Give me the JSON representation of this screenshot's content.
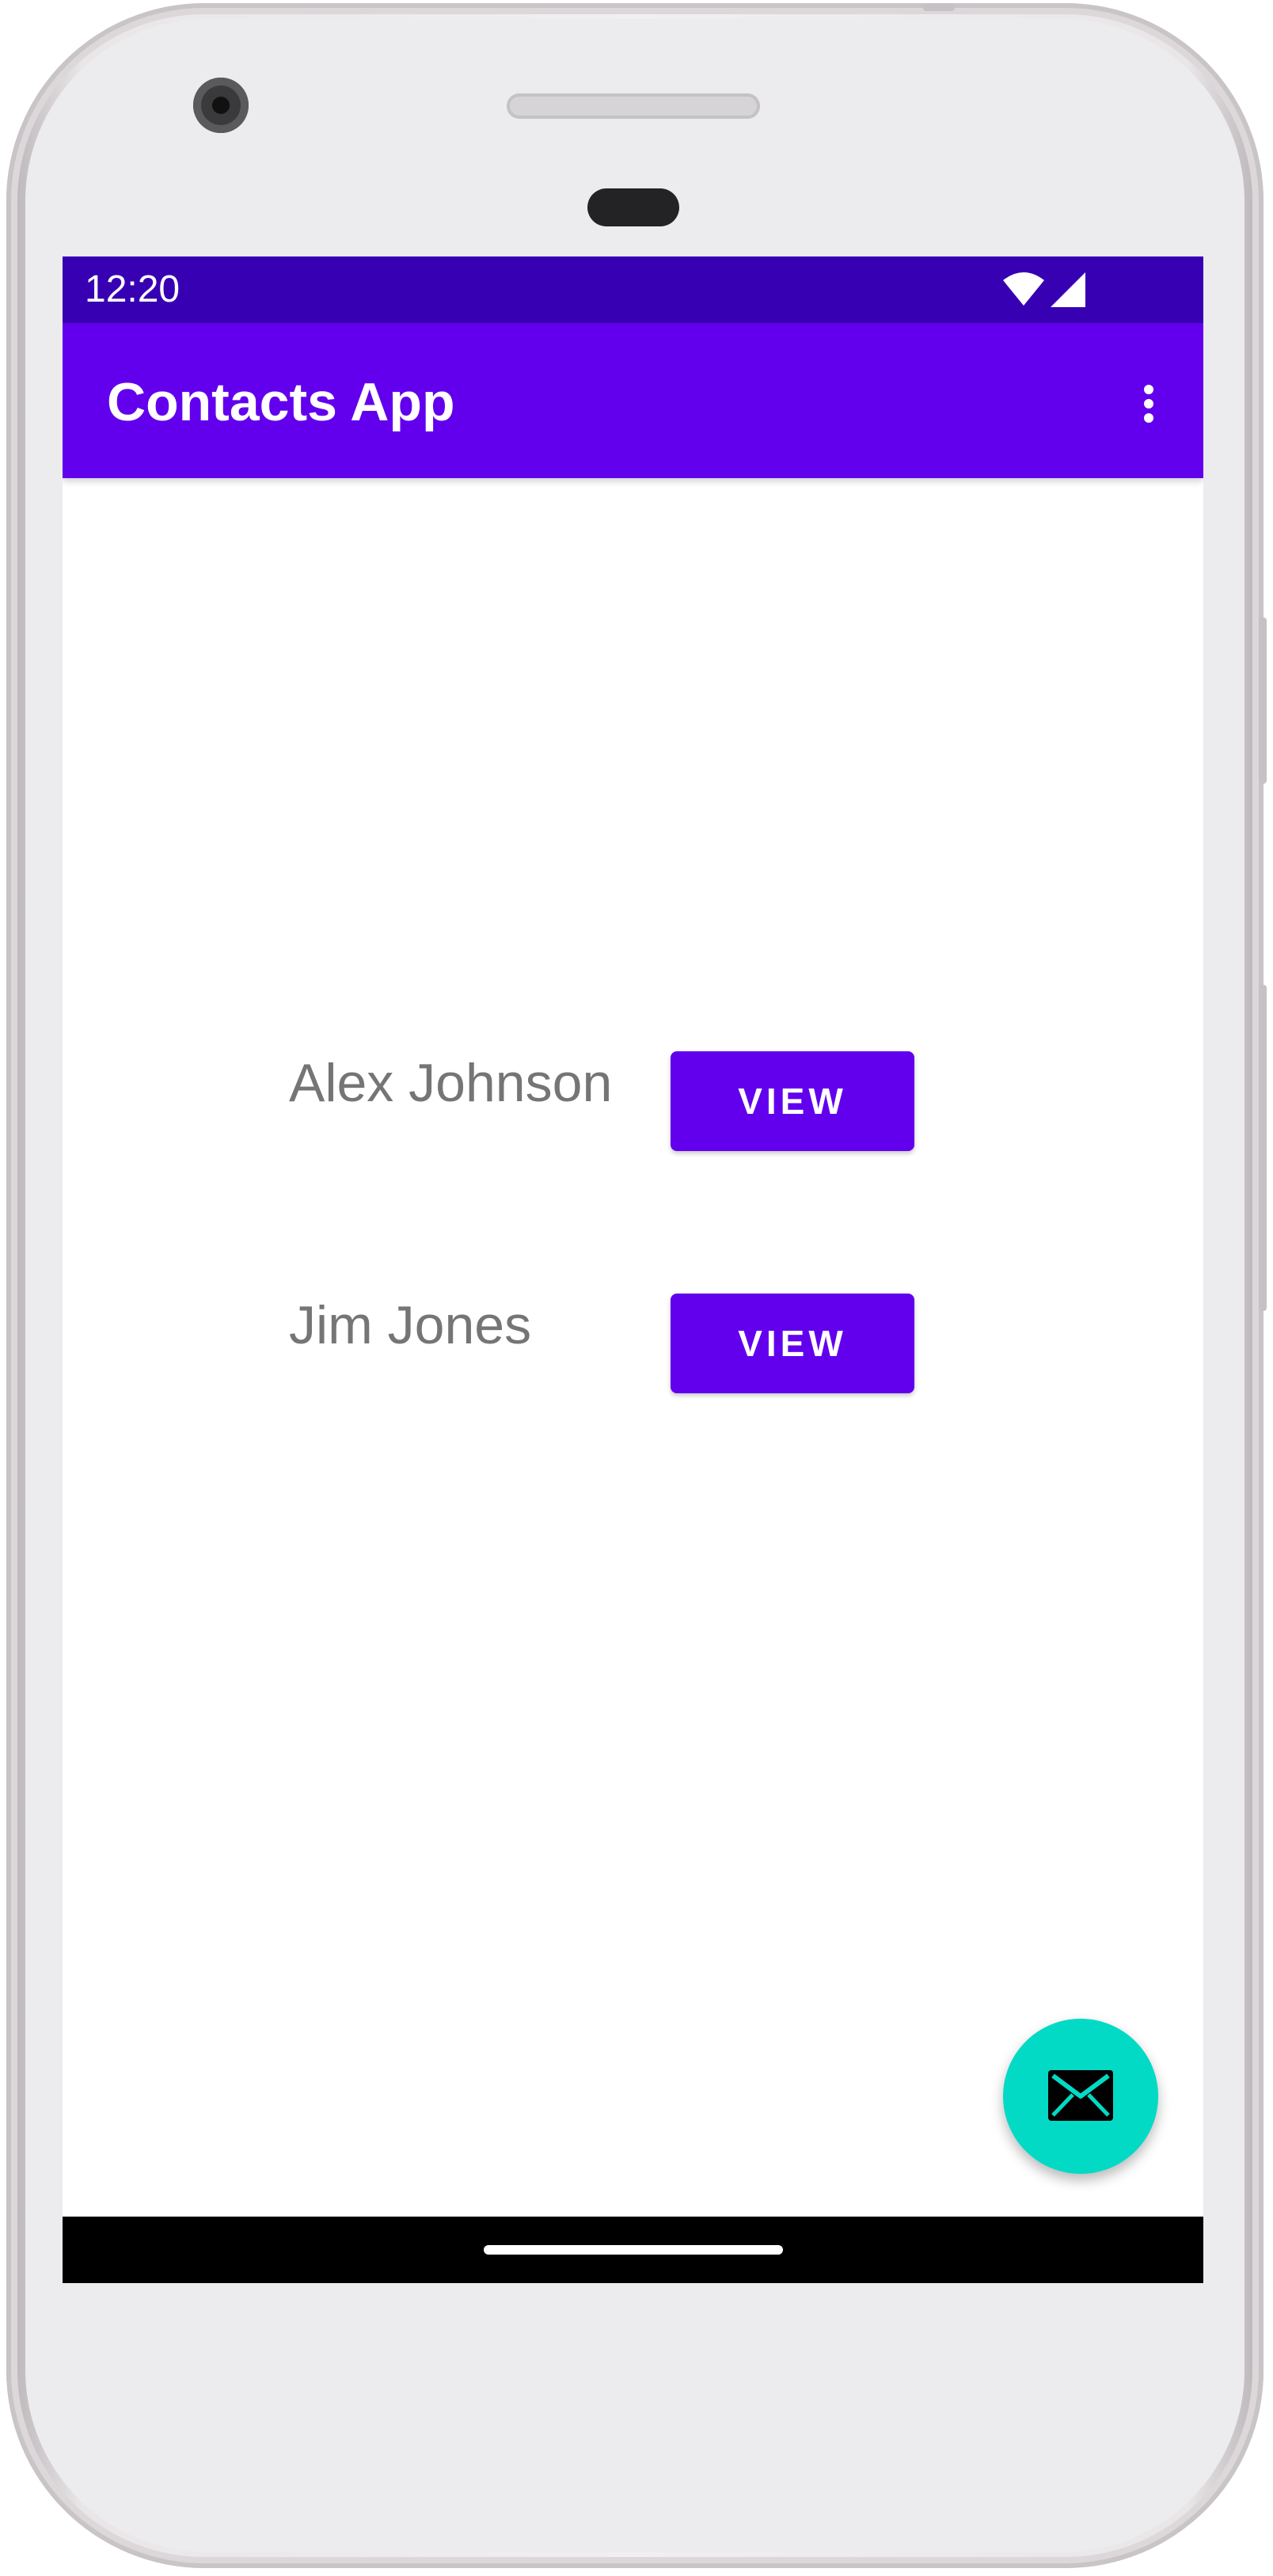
{
  "status_bar": {
    "time": "12:20",
    "icons": [
      "wifi-icon",
      "cellular-signal-icon"
    ]
  },
  "app_bar": {
    "title": "Contacts App",
    "menu_icon": "more-vert-icon"
  },
  "contacts": [
    {
      "name": "Alex Johnson",
      "button_label": "VIEW"
    },
    {
      "name": "Jim Jones",
      "button_label": "VIEW"
    }
  ],
  "fab": {
    "icon": "email-icon"
  },
  "colors": {
    "primary": "#6200ee",
    "primary_dark": "#3700b3",
    "accent": "#03dac5",
    "name_text": "#757575"
  }
}
